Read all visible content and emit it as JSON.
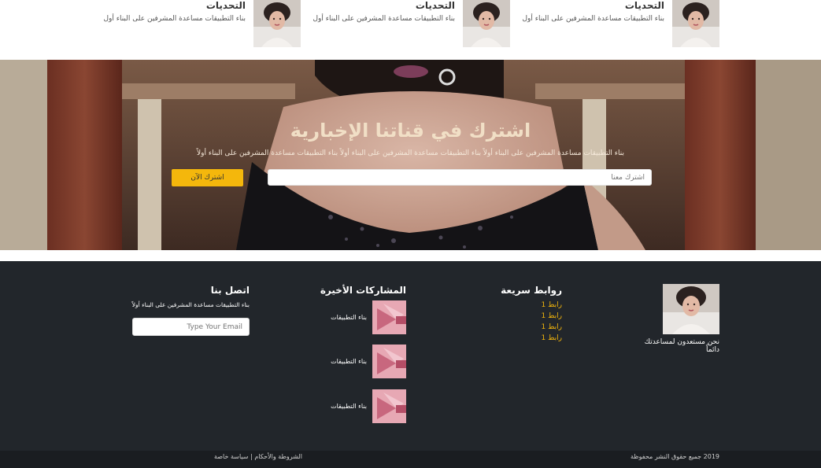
{
  "top_cards": [
    {
      "title": "التحديات",
      "desc": "بناء التطبيقات مساعدة المشرفين على البناء أول"
    },
    {
      "title": "التحديات",
      "desc": "بناء التطبيقات مساعدة المشرفين على البناء أول"
    },
    {
      "title": "التحديات",
      "desc": "بناء التطبيقات مساعدة المشرفين على البناء أول"
    }
  ],
  "newsletter": {
    "title": "اشترك في قناتنا الإخبارية",
    "subtitle": "بناء التطبيقات مساعدة المشرفين على البناء أولاً بناء التطبيقات مساعدة المشرفين على البناء أولاً بناء التطبيقات مساعدة المشرفين على البناء أولاً",
    "input_placeholder": "اشترك معنا",
    "button_label": "اشترك الآن"
  },
  "footer": {
    "about": {
      "text": "نحن مستعدون لمساعدتك دائماً"
    },
    "quick_links": {
      "title": "روابط سريعة",
      "items": [
        "رابط 1",
        "رابط 1",
        "رابط 1",
        "رابط 1"
      ]
    },
    "recent_posts": {
      "title": "المشاركات الأخيرة",
      "items": [
        {
          "label": "بناء التطبيقات"
        },
        {
          "label": "بناء التطبيقات"
        },
        {
          "label": "بناء التطبيقات"
        }
      ]
    },
    "contact": {
      "title": "اتصل بنا",
      "desc": "بناء التطبيقات مساعدة المشرفين على البناء أولاً",
      "email_placeholder": "Type Your Email"
    }
  },
  "bottom_bar": {
    "copyright": "2019 جميع حقوق النشر محفوظة",
    "terms": "الشروطة والأحكام",
    "separator": "|",
    "privacy": "سياسة خاصة"
  },
  "colors": {
    "accent": "#f4b70c",
    "footer_bg": "#22262b",
    "bottom_bg": "#1a1d21"
  }
}
